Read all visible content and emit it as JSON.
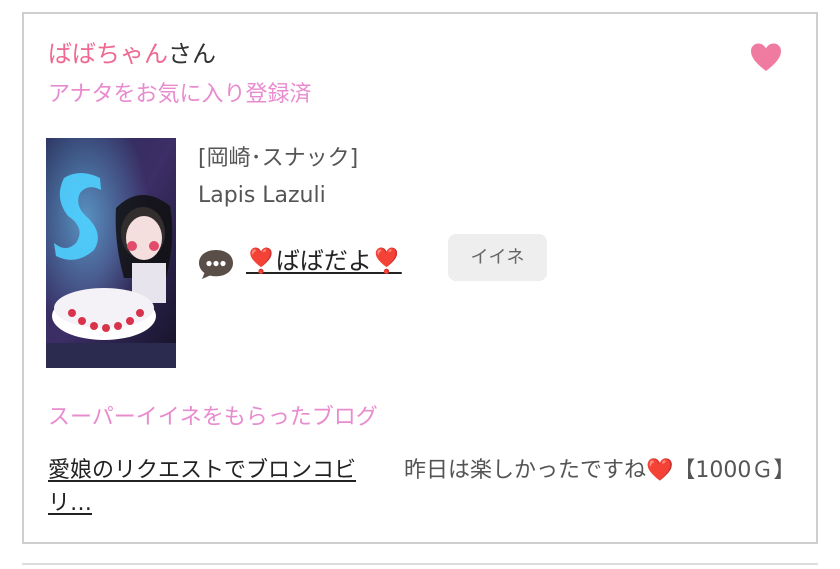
{
  "user": {
    "name": "ばばちゃん",
    "suffix": "さん",
    "favorite_status": "アナタをお気に入り登録済"
  },
  "shop": {
    "category": "[岡崎･スナック]",
    "name": "Lapis Lazuli"
  },
  "blog": {
    "link_text": "❣️ばばだよ❣️",
    "iine_label": "イイネ"
  },
  "super_iine": {
    "heading": "スーパーイイネをもらったブログ",
    "blog_title": "愛娘のリクエストでブロンコビリ…",
    "comment": "昨日は楽しかったですね❤️【1000Ｇ】"
  },
  "icons": {
    "favorite": "heart-icon",
    "chat": "speech-bubble-icon"
  },
  "colors": {
    "pink": "#ef6a92",
    "light_pink": "#e88bcf",
    "heart": "#f07ba0"
  }
}
